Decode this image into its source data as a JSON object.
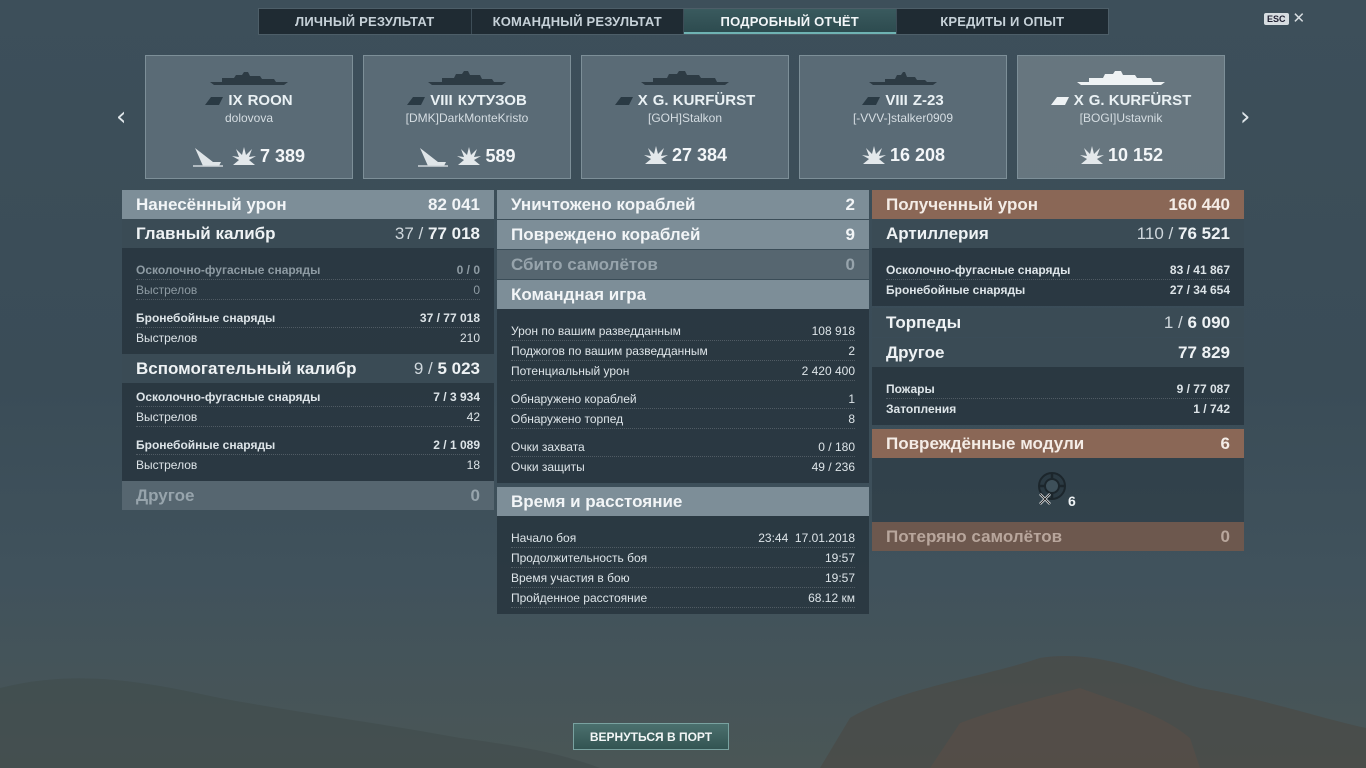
{
  "tabs": [
    "ЛИЧНЫЙ РЕЗУЛЬТАТ",
    "КОМАНДНЫЙ РЕЗУЛЬТАТ",
    "ПОДРОБНЫЙ ОТЧЁТ",
    "КРЕДИТЫ И ОПЫТ"
  ],
  "active_tab": 2,
  "esc": {
    "key": "ESC",
    "close": "✕"
  },
  "cards": [
    {
      "tier": "IX",
      "name": "ROON",
      "player": "dolovova",
      "damage": "7 389",
      "sunk_icon": true
    },
    {
      "tier": "VIII",
      "name": "КУТУЗОВ",
      "player": "[DMK]DarkMonteKristo",
      "damage": "589",
      "sunk_icon": true
    },
    {
      "tier": "X",
      "name": "G. KURFÜRST",
      "player": "[GOH]Stalkon",
      "damage": "27 384",
      "sunk_icon": false
    },
    {
      "tier": "VIII",
      "name": "Z-23",
      "player": "[-VVV-]stalker0909",
      "damage": "16 208",
      "sunk_icon": false
    },
    {
      "tier": "X",
      "name": "G. KURFÜRST",
      "player": "[BOGI]Ustavnik",
      "damage": "10 152",
      "sunk_icon": false
    }
  ],
  "left": {
    "dealt": {
      "label": "Нанесённый урон",
      "value": "82 041"
    },
    "main": {
      "label": "Главный калибр",
      "hits": "37",
      "dmg": "77 018"
    },
    "main_he": {
      "label": "Осколочно-фугасные снаряды",
      "value": "0 / 0"
    },
    "main_he_shots": {
      "label": "Выстрелов",
      "value": "0"
    },
    "main_ap": {
      "label": "Бронебойные снаряды",
      "hits": "37",
      "dmg": "77 018"
    },
    "main_ap_shots": {
      "label": "Выстрелов",
      "value": "210"
    },
    "sec": {
      "label": "Вспомогательный калибр",
      "hits": "9",
      "dmg": "5 023"
    },
    "sec_he": {
      "label": "Осколочно-фугасные снаряды",
      "hits": "7",
      "dmg": "3 934"
    },
    "sec_he_shots": {
      "label": "Выстрелов",
      "value": "42"
    },
    "sec_ap": {
      "label": "Бронебойные снаряды",
      "hits": "2",
      "dmg": "1 089"
    },
    "sec_ap_shots": {
      "label": "Выстрелов",
      "value": "18"
    },
    "other": {
      "label": "Другое",
      "value": "0"
    }
  },
  "middle": {
    "destroyed": {
      "label": "Уничтожено кораблей",
      "value": "2"
    },
    "damaged": {
      "label": "Повреждено кораблей",
      "value": "9"
    },
    "planes": {
      "label": "Сбито самолётов",
      "value": "0"
    },
    "team": {
      "label": "Командная игра"
    },
    "team_rows": [
      {
        "label": "Урон по вашим разведданным",
        "value": "108 918"
      },
      {
        "label": "Поджогов по вашим разведданным",
        "value": "2"
      },
      {
        "label": "Потенциальный урон",
        "value": "2 420 400"
      },
      {
        "label": "Обнаружено кораблей",
        "value": "1"
      },
      {
        "label": "Обнаружено торпед",
        "value": "8"
      },
      {
        "label": "Очки захвата",
        "value": "0 / 180"
      },
      {
        "label": "Очки защиты",
        "value": "49 / 236"
      }
    ],
    "time": {
      "label": "Время и расстояние"
    },
    "time_rows": [
      {
        "label": "Начало боя",
        "value": "23:44  17.01.2018"
      },
      {
        "label": "Продолжительность боя",
        "value": "19:57"
      },
      {
        "label": "Время участия в бою",
        "value": "19:57"
      },
      {
        "label": "Пройденное расстояние",
        "value": "68.12 км"
      }
    ]
  },
  "right": {
    "received": {
      "label": "Полученный урон",
      "value": "160 440"
    },
    "artillery": {
      "label": "Артиллерия",
      "hits": "110",
      "dmg": "76 521"
    },
    "art_he": {
      "label": "Осколочно-фугасные снаряды",
      "hits": "83",
      "dmg": "41 867"
    },
    "art_ap": {
      "label": "Бронебойные снаряды",
      "hits": "27",
      "dmg": "34 654"
    },
    "torp": {
      "label": "Торпеды",
      "hits": "1",
      "dmg": "6 090"
    },
    "other": {
      "label": "Другое",
      "value": "77 829"
    },
    "fires": {
      "label": "Пожары",
      "hits": "9",
      "dmg": "77 087"
    },
    "flood": {
      "label": "Затопления",
      "hits": "1",
      "dmg": "742"
    },
    "modules": {
      "label": "Повреждённые модули",
      "value": "6",
      "count": "6"
    },
    "lost_planes": {
      "label": "Потеряно самолётов",
      "value": "0"
    }
  },
  "button": {
    "port": "ВЕРНУТЬСЯ В ПОРТ"
  }
}
